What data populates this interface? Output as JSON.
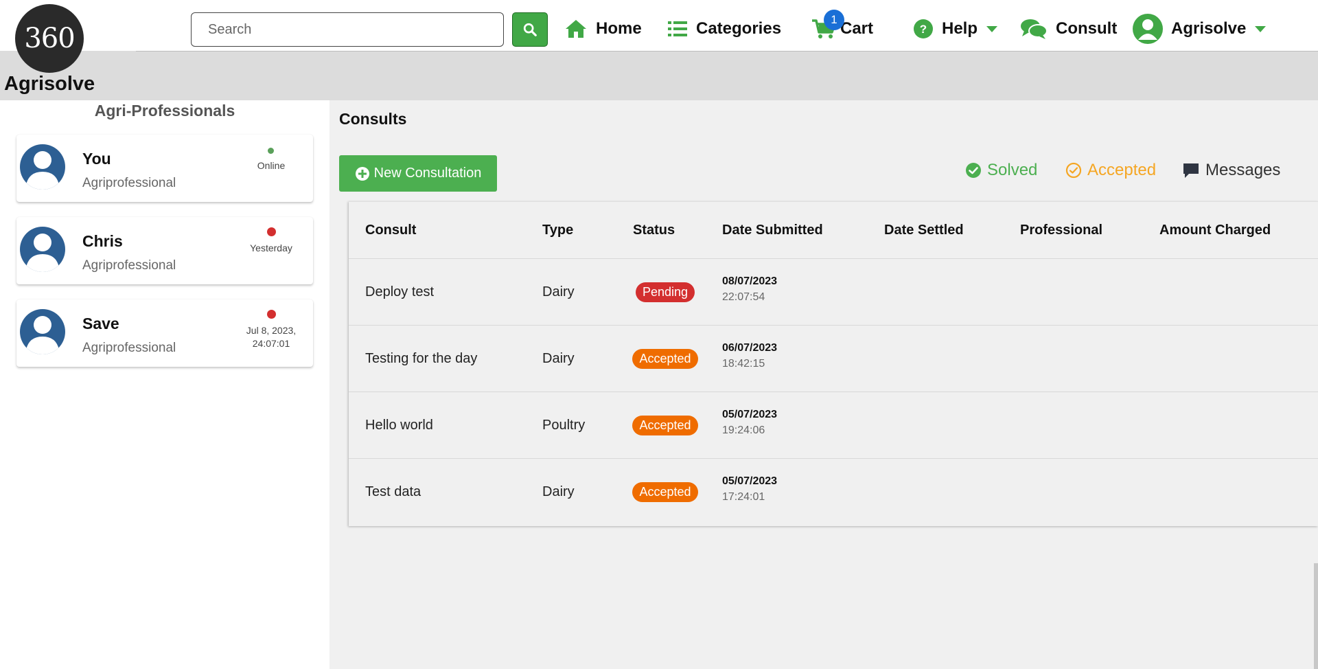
{
  "brand": {
    "logo_text": "360",
    "name": "Agrisolve"
  },
  "header": {
    "search_placeholder": "Search",
    "nav": {
      "home": "Home",
      "categories": "Categories",
      "cart": "Cart",
      "cart_count": "1",
      "help": "Help",
      "consult": "Consult",
      "user": "Agrisolve"
    }
  },
  "sidebar": {
    "title": "Agri-Professionals",
    "professionals": [
      {
        "name": "You",
        "role": "Agriprofessional",
        "status": "Online",
        "status_color": "#5aa05a"
      },
      {
        "name": "Chris",
        "role": "Agriprofessional",
        "status": "Yesterday",
        "status_color": "#d32f2f"
      },
      {
        "name": "Save",
        "role": "Agriprofessional",
        "status": "Jul 8, 2023, 24:07:01",
        "status_color": "#d32f2f"
      }
    ]
  },
  "main": {
    "title": "Consults",
    "new_button": "New Consultation",
    "legend": {
      "solved": "Solved",
      "accepted": "Accepted",
      "messages": "Messages"
    },
    "table": {
      "columns": [
        "Consult",
        "Type",
        "Status",
        "Date Submitted",
        "Date Settled",
        "Professional",
        "Amount Charged"
      ],
      "rows": [
        {
          "consult": "Deploy test",
          "type": "Dairy",
          "status": "Pending",
          "date": "08/07/2023",
          "time": "22:07:54",
          "settled": "",
          "professional": "",
          "amount": ""
        },
        {
          "consult": "Testing for the day",
          "type": "Dairy",
          "status": "Accepted",
          "date": "06/07/2023",
          "time": "18:42:15",
          "settled": "",
          "professional": "",
          "amount": ""
        },
        {
          "consult": "Hello world",
          "type": "Poultry",
          "status": "Accepted",
          "date": "05/07/2023",
          "time": "19:24:06",
          "settled": "",
          "professional": "",
          "amount": ""
        },
        {
          "consult": "Test data",
          "type": "Dairy",
          "status": "Accepted",
          "date": "05/07/2023",
          "time": "17:24:01",
          "settled": "",
          "professional": "",
          "amount": ""
        }
      ]
    }
  },
  "colors": {
    "brand_green": "#41a846",
    "pending": "#d32f2f",
    "accepted": "#ef6c00",
    "accepted_text": "#f5a623",
    "solved": "#4caf50",
    "messages": "#333333"
  }
}
